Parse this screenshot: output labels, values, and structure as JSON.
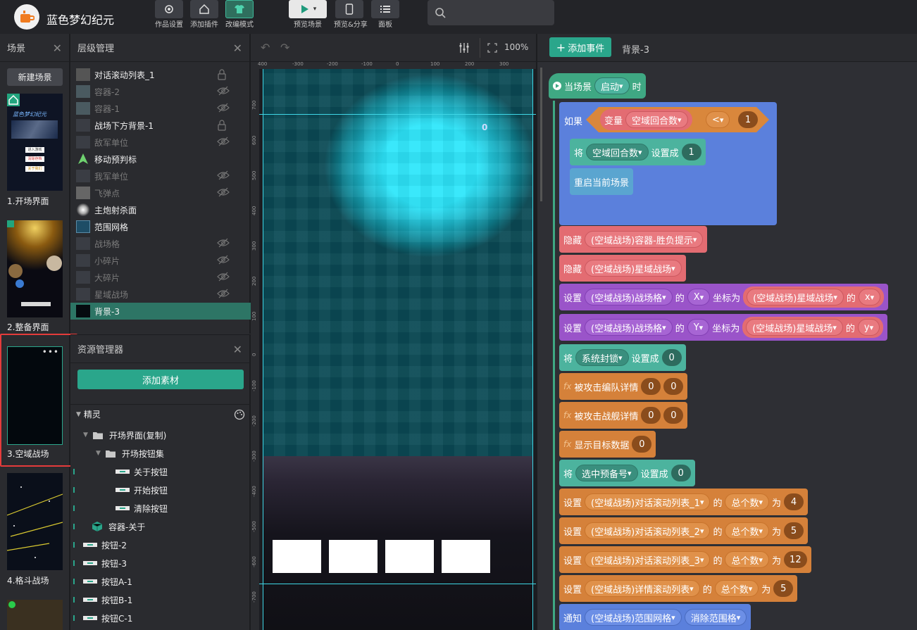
{
  "app": {
    "title": "蓝色梦幻纪元"
  },
  "toolbar": {
    "items": [
      {
        "label": "作品设置",
        "icon": "gear-icon"
      },
      {
        "label": "添加插件",
        "icon": "home-plugin-icon"
      },
      {
        "label": "改编模式",
        "icon": "shirt-icon"
      },
      {
        "label": "预览场景",
        "icon": "play-icon"
      },
      {
        "label": "预览&分享",
        "icon": "phone-icon"
      },
      {
        "label": "面板",
        "icon": "list-icon"
      }
    ],
    "search_placeholder": ""
  },
  "scene_panel": {
    "title": "场景",
    "new_scene_label": "新建场景",
    "scenes": [
      {
        "label": "1.开场界面"
      },
      {
        "label": "2.整备界面"
      },
      {
        "label": "3.空域战场",
        "selected": true
      },
      {
        "label": "4.格斗战场"
      }
    ],
    "thumb1_title": "蓝色梦幻纪元",
    "thumb1_buttons": [
      "进入游戏",
      "清除存档",
      "关于我们"
    ]
  },
  "layer_panel": {
    "title": "层级管理",
    "layers": [
      {
        "name": "对话滚动列表_1",
        "visible": true,
        "icon": "list-layer-icon",
        "locked": true
      },
      {
        "name": "容器-2",
        "visible": false,
        "icon": "container-icon"
      },
      {
        "name": "容器-1",
        "visible": false,
        "icon": "container-icon"
      },
      {
        "name": "战场下方背景-1",
        "visible": true,
        "icon": "image-layer-icon",
        "locked": true
      },
      {
        "name": "敌军单位",
        "visible": false,
        "icon": "image-layer-icon"
      },
      {
        "name": "移动预判标",
        "visible": true,
        "icon": "arrow-layer-icon"
      },
      {
        "name": "我军单位",
        "visible": false,
        "icon": "image-layer-icon"
      },
      {
        "name": "飞弹点",
        "visible": false,
        "icon": "dot-layer-icon"
      },
      {
        "name": "主炮射杀面",
        "visible": true,
        "icon": "glow-layer-icon"
      },
      {
        "name": "范围网格",
        "visible": true,
        "icon": "grid-layer-icon"
      },
      {
        "name": "战场格",
        "visible": false,
        "icon": "image-layer-icon"
      },
      {
        "name": "小碎片",
        "visible": false,
        "icon": "image-layer-icon"
      },
      {
        "name": "大碎片",
        "visible": false,
        "icon": "image-layer-icon"
      },
      {
        "name": "星域战场",
        "visible": false,
        "icon": "image-layer-icon"
      },
      {
        "name": "背景-3",
        "visible": true,
        "icon": "image-layer-icon",
        "selected": true
      }
    ]
  },
  "asset_panel": {
    "title": "资源管理器",
    "add_label": "添加素材",
    "section": "精灵",
    "tree": [
      {
        "label": "开场界面(复制)",
        "type": "folder",
        "indent": 0
      },
      {
        "label": "开场按钮集",
        "type": "folder",
        "indent": 1
      },
      {
        "label": "关于按钮",
        "type": "button",
        "indent": 2
      },
      {
        "label": "开始按钮",
        "type": "button",
        "indent": 2
      },
      {
        "label": "清除按钮",
        "type": "button",
        "indent": 2
      },
      {
        "label": "容器-关于",
        "type": "container",
        "indent": 0
      },
      {
        "label": "按钮-2",
        "type": "button",
        "indent": 0
      },
      {
        "label": "按钮-3",
        "type": "button",
        "indent": 0
      },
      {
        "label": "按钮A-1",
        "type": "button",
        "indent": 0
      },
      {
        "label": "按钮B-1",
        "type": "button",
        "indent": 0
      },
      {
        "label": "按钮C-1",
        "type": "button",
        "indent": 0
      }
    ]
  },
  "canvas": {
    "zoom": "100%",
    "ruler_top": [
      "400",
      "-300",
      "-200",
      "-100",
      "0",
      "100",
      "200",
      "300"
    ],
    "ruler_left": [
      "700",
      "600",
      "500",
      "400",
      "300",
      "200",
      "100",
      "0",
      "-100",
      "-200",
      "-300",
      "-400",
      "-500",
      "-600",
      "-700"
    ],
    "overlay_number": "0"
  },
  "event_panel": {
    "add_label": "添加事件",
    "scene_label": "背景-3",
    "hat": {
      "t1": "当场景",
      "event": "启动",
      "t2": "时"
    },
    "if_block": {
      "if_label": "如果",
      "var_label": "变量",
      "var_name": "空域回合数",
      "op": "<",
      "value": "1",
      "set_prefix": "将",
      "set_var": "空域回合数",
      "set_mid": "设置成",
      "set_value": "1",
      "restart_label": "重启当前场景"
    },
    "actions": [
      {
        "kind": "hide",
        "verb": "隐藏",
        "target": "(空域战场)容器-胜负提示"
      },
      {
        "kind": "hide",
        "verb": "隐藏",
        "target": "(空域战场)星域战场"
      },
      {
        "kind": "setcoord",
        "verb": "设置",
        "target": "(空域战场)战场格",
        "de": "的",
        "axis": "X",
        "mid": "坐标为",
        "src": "(空域战场)星域战场",
        "de2": "的",
        "prop": "x"
      },
      {
        "kind": "setcoord",
        "verb": "设置",
        "target": "(空域战场)战场格",
        "de": "的",
        "axis": "Y",
        "mid": "坐标为",
        "src": "(空域战场)星域战场",
        "de2": "的",
        "prop": "y"
      },
      {
        "kind": "setvar",
        "verb": "将",
        "target": "系统封锁",
        "mid": "设置成",
        "value": "0"
      },
      {
        "kind": "fx",
        "fx": "fx",
        "label": "被攻击编队详情",
        "args": [
          "0",
          "0"
        ]
      },
      {
        "kind": "fx",
        "fx": "fx",
        "label": "被攻击战舰详情",
        "args": [
          "0",
          "0"
        ]
      },
      {
        "kind": "fx",
        "fx": "fx",
        "label": "显示目标数据",
        "args": [
          "0"
        ]
      },
      {
        "kind": "setvar",
        "verb": "将",
        "target": "选中预备号",
        "mid": "设置成",
        "value": "0"
      },
      {
        "kind": "setprop",
        "verb": "设置",
        "target": "(空域战场)对话滚动列表_1",
        "de": "的",
        "prop": "总个数",
        "wei": "为",
        "value": "4"
      },
      {
        "kind": "setprop",
        "verb": "设置",
        "target": "(空域战场)对话滚动列表_2",
        "de": "的",
        "prop": "总个数",
        "wei": "为",
        "value": "5"
      },
      {
        "kind": "setprop",
        "verb": "设置",
        "target": "(空域战场)对话滚动列表_3",
        "de": "的",
        "prop": "总个数",
        "wei": "为",
        "value": "12"
      },
      {
        "kind": "setprop",
        "verb": "设置",
        "target": "(空域战场)详情滚动列表",
        "de": "的",
        "prop": "总个数",
        "wei": "为",
        "value": "5"
      },
      {
        "kind": "notify",
        "verb": "通知",
        "target": "(空域战场)范围网格",
        "msg": "消除范围格"
      }
    ]
  }
}
